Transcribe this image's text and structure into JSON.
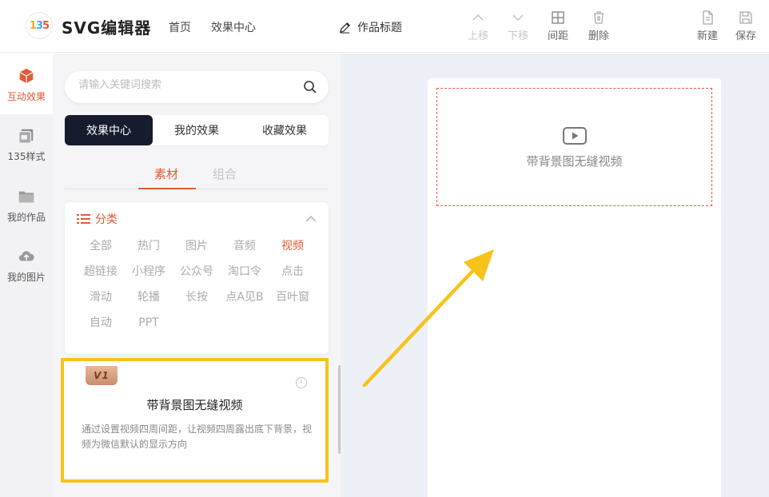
{
  "header": {
    "logo_text": "135",
    "app_title": "SVG编辑器",
    "nav": [
      "首页",
      "效果中心"
    ],
    "work_title": "作品标题",
    "tools": {
      "move_up": "上移",
      "move_down": "下移",
      "spacing": "间距",
      "delete": "删除",
      "new": "新建",
      "save": "保存"
    }
  },
  "rail": {
    "items": [
      {
        "label": "互动效果",
        "icon": "cube-icon"
      },
      {
        "label": "135样式",
        "icon": "layers-icon"
      },
      {
        "label": "我的作品",
        "icon": "folder-icon"
      },
      {
        "label": "我的图片",
        "icon": "cloud-upload-icon"
      }
    ]
  },
  "panel": {
    "search_placeholder": "请输入关键词搜索",
    "tabs": [
      "效果中心",
      "我的效果",
      "收藏效果"
    ],
    "subtabs": [
      "素材",
      "组合"
    ],
    "category_title": "分类",
    "categories": [
      "全部",
      "热门",
      "图片",
      "音频",
      "视频",
      "超链接",
      "小程序",
      "公众号",
      "淘口令",
      "点击",
      "滑动",
      "轮播",
      "长按",
      "点A见B",
      "百叶窗",
      "自动",
      "PPT"
    ],
    "active_category": "视频"
  },
  "effect_card": {
    "badge": "V1",
    "title": "带背景图无缝视频",
    "description": "通过设置视频四周间距，让视频四周露出底下背景，视频为微信默认的显示方向"
  },
  "canvas": {
    "placeholder_label": "带背景图无缝视频"
  },
  "colors": {
    "accent": "#e25a36",
    "highlight": "#f7c21a",
    "dark_tab": "#161b2e"
  }
}
